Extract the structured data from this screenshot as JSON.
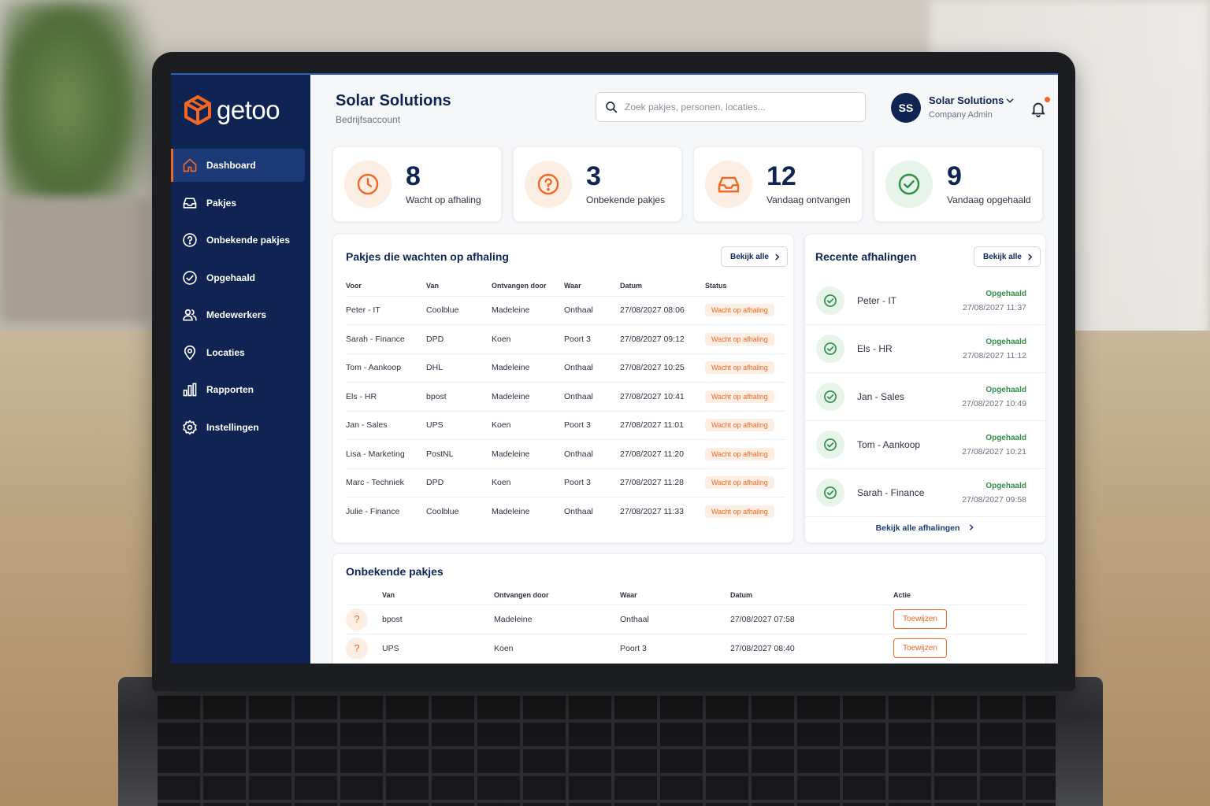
{
  "brand": {
    "logo_text": "getoo",
    "accent": "#f26722",
    "navy": "#0f2452"
  },
  "sidebar": {
    "items": [
      {
        "label": "Dashboard",
        "icon": "home-icon",
        "active": true
      },
      {
        "label": "Pakjes",
        "icon": "inbox-icon"
      },
      {
        "label": "Onbekende pakjes",
        "icon": "question-circle-icon"
      },
      {
        "label": "Opgehaald",
        "icon": "check-circle-icon"
      },
      {
        "label": "Medewerkers",
        "icon": "users-icon"
      },
      {
        "label": "Locaties",
        "icon": "map-pin-icon"
      },
      {
        "label": "Rapporten",
        "icon": "bar-chart-icon"
      },
      {
        "label": "Instellingen",
        "icon": "gear-icon"
      }
    ]
  },
  "header": {
    "company": "Solar Solutions",
    "account_type": "Bedrijfsaccount",
    "search_placeholder": "Zoek pakjes, personen, locaties...",
    "user": {
      "initials": "SS",
      "name": "Solar Solutions",
      "role": "Company Admin"
    }
  },
  "stats": [
    {
      "value": "8",
      "label": "Wacht op afhaling",
      "icon": "clock-icon",
      "tone": "orange"
    },
    {
      "value": "3",
      "label": "Onbekende pakjes",
      "icon": "question-circle-icon",
      "tone": "orange"
    },
    {
      "value": "12",
      "label": "Vandaag ontvangen",
      "icon": "inbox-icon",
      "tone": "orange"
    },
    {
      "value": "9",
      "label": "Vandaag opgehaald",
      "icon": "check-circle-icon",
      "tone": "green"
    }
  ],
  "waiting": {
    "title": "Pakjes die wachten op afhaling",
    "view_all": "Bekijk alle",
    "columns": [
      "Voor",
      "Van",
      "Ontvangen door",
      "Waar",
      "Datum",
      "Status"
    ],
    "rows": [
      [
        "Peter - IT",
        "Coolblue",
        "Madeleine",
        "Onthaal",
        "27/08/2027 08:06",
        "Wacht op afhaling"
      ],
      [
        "Sarah - Finance",
        "DPD",
        "Koen",
        "Poort 3",
        "27/08/2027 09:12",
        "Wacht op afhaling"
      ],
      [
        "Tom - Aankoop",
        "DHL",
        "Madeleine",
        "Onthaal",
        "27/08/2027 10:25",
        "Wacht op afhaling"
      ],
      [
        "Els - HR",
        "bpost",
        "Madeleine",
        "Onthaal",
        "27/08/2027 10:41",
        "Wacht op afhaling"
      ],
      [
        "Jan - Sales",
        "UPS",
        "Koen",
        "Poort 3",
        "27/08/2027 11:01",
        "Wacht op afhaling"
      ],
      [
        "Lisa - Marketing",
        "PostNL",
        "Madeleine",
        "Onthaal",
        "27/08/2027 11:20",
        "Wacht op afhaling"
      ],
      [
        "Marc - Techniek",
        "DPD",
        "Koen",
        "Poort 3",
        "27/08/2027 11:28",
        "Wacht op afhaling"
      ],
      [
        "Julie - Finance",
        "Coolblue",
        "Madeleine",
        "Onthaal",
        "27/08/2027 11:33",
        "Wacht op afhaling"
      ]
    ]
  },
  "recent": {
    "title": "Recente afhalingen",
    "view_all": "Bekijk alle",
    "footer_link": "Bekijk alle afhalingen",
    "items": [
      {
        "name": "Peter - IT",
        "status": "Opgehaald",
        "time": "27/08/2027 11:37"
      },
      {
        "name": "Els - HR",
        "status": "Opgehaald",
        "time": "27/08/2027 11:12"
      },
      {
        "name": "Jan - Sales",
        "status": "Opgehaald",
        "time": "27/08/2027 10:49"
      },
      {
        "name": "Tom - Aankoop",
        "status": "Opgehaald",
        "time": "27/08/2027 10:21"
      },
      {
        "name": "Sarah - Finance",
        "status": "Opgehaald",
        "time": "27/08/2027 09:58"
      }
    ]
  },
  "unknown": {
    "title": "Onbekende pakjes",
    "columns": [
      "",
      "Van",
      "Ontvangen door",
      "Waar",
      "Datum",
      "Actie"
    ],
    "action_label": "Toewijzen",
    "marker": "?",
    "rows": [
      [
        "bpost",
        "Madeleine",
        "Onthaal",
        "27/08/2027 07:58"
      ],
      [
        "UPS",
        "Koen",
        "Poort 3",
        "27/08/2027 08:40"
      ]
    ]
  }
}
